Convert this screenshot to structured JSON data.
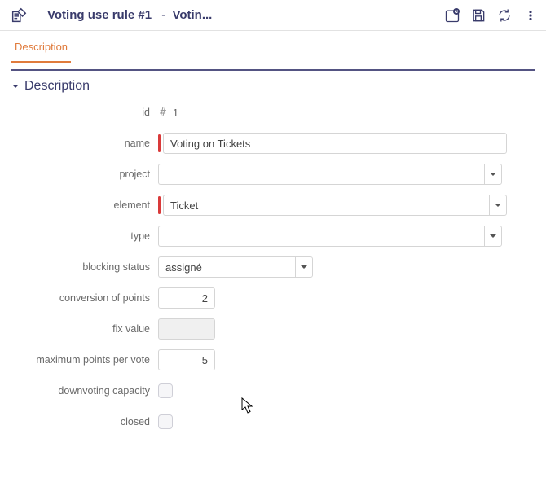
{
  "header": {
    "title_main": "Voting use rule  #1",
    "title_sep": " - ",
    "title_sub": "Votin...",
    "icons": {
      "title": "edit-paper-icon",
      "schedule": "schedule-icon",
      "save": "save-icon",
      "refresh": "refresh-icon",
      "menu": "kebab-icon"
    }
  },
  "tabs": {
    "active": "Description"
  },
  "section": {
    "title": "Description"
  },
  "fields": {
    "id": {
      "label": "id",
      "value": "1"
    },
    "name": {
      "label": "name",
      "value": "Voting on Tickets"
    },
    "project": {
      "label": "project",
      "value": ""
    },
    "element": {
      "label": "element",
      "value": "Ticket"
    },
    "type": {
      "label": "type",
      "value": ""
    },
    "blocking_status": {
      "label": "blocking status",
      "value": "assigné"
    },
    "conversion_of_points": {
      "label": "conversion of points",
      "value": "2"
    },
    "fix_value": {
      "label": "fix value",
      "value": ""
    },
    "maximum_points_per_vote": {
      "label": "maximum points per vote",
      "value": "5"
    },
    "downvoting_capacity": {
      "label": "downvoting capacity",
      "checked": false
    },
    "closed": {
      "label": "closed",
      "checked": false
    }
  }
}
